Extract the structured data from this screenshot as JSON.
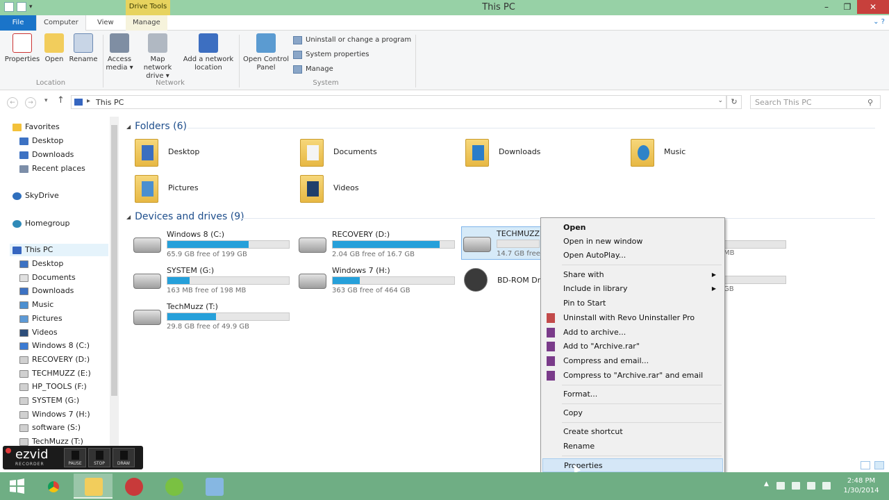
{
  "window": {
    "title": "This PC",
    "contextual_tab": "Drive Tools"
  },
  "ribbon": {
    "tabs": [
      "File",
      "Computer",
      "View",
      "Manage"
    ],
    "location": {
      "group_label": "Location",
      "buttons": [
        "Properties",
        "Open",
        "Rename"
      ]
    },
    "network": {
      "group_label": "Network",
      "access_media": "Access media",
      "map_drive": "Map network drive",
      "add_location": "Add a network location"
    },
    "system": {
      "group_label": "System",
      "open_control_panel": "Open Control Panel",
      "uninstall": "Uninstall or change a program",
      "system_properties": "System properties",
      "manage": "Manage"
    }
  },
  "address": {
    "path": "This PC",
    "search_placeholder": "Search This PC"
  },
  "nav": {
    "favorites": "Favorites",
    "favorites_items": [
      "Desktop",
      "Downloads",
      "Recent places"
    ],
    "skydrive": "SkyDrive",
    "homegroup": "Homegroup",
    "this_pc": "This PC",
    "pc_items": [
      "Desktop",
      "Documents",
      "Downloads",
      "Music",
      "Pictures",
      "Videos",
      "Windows 8 (C:)",
      "RECOVERY (D:)",
      "TECHMUZZ (E:)",
      "HP_TOOLS (F:)",
      "SYSTEM (G:)",
      "Windows 7 (H:)",
      "software (S:)",
      "TechMuzz (T:)"
    ]
  },
  "content": {
    "folders_header": "Folders (6)",
    "folders": [
      "Desktop",
      "Documents",
      "Downloads",
      "Music",
      "Pictures",
      "Videos"
    ],
    "drives_header": "Devices and drives (9)",
    "drives": [
      {
        "name": "Windows 8 (C:)",
        "free": "65.9 GB free of 199 GB",
        "used_fraction": 0.67
      },
      {
        "name": "RECOVERY (D:)",
        "free": "2.04 GB free of 16.7 GB",
        "used_fraction": 0.88
      },
      {
        "name": "TECHMUZZ",
        "free": "14.7 GB free",
        "used_fraction": 0.0
      },
      {
        "name": "SYSTEM (G:)",
        "free": "163 MB free of 198 MB",
        "used_fraction": 0.18
      },
      {
        "name": "Windows 7 (H:)",
        "free": "363 GB free of 464 GB",
        "used_fraction": 0.22
      },
      {
        "name": "BD-ROM Dri",
        "free": "",
        "used_fraction": null
      },
      {
        "name": "TechMuzz (T:)",
        "free": "29.8 GB free of 49.9 GB",
        "used_fraction": 0.4
      }
    ],
    "partial_right": [
      "MB",
      "GB"
    ]
  },
  "context_menu": {
    "items": [
      "Open",
      "Open in new window",
      "Open AutoPlay...",
      "Share with",
      "Include in library",
      "Pin to Start",
      "Uninstall with Revo Uninstaller Pro",
      "Add to archive...",
      "Add to \"Archive.rar\"",
      "Compress and email...",
      "Compress to \"Archive.rar\" and email",
      "Format...",
      "Copy",
      "Create shortcut",
      "Rename",
      "Properties"
    ]
  },
  "ezvid": {
    "logo": "ezvid",
    "sub": "RECORDER",
    "buttons": [
      "PAUSE",
      "STOP",
      "DRAW"
    ]
  },
  "taskbar": {
    "time": "2:48 PM",
    "date": "1/30/2014"
  },
  "colors": {
    "titlebar": "#97d1a6",
    "drive_tools": "#e7d35e",
    "file_tab": "#1a74c9",
    "taskbar": "#6fae84",
    "drive_bar": "#26a0da",
    "accent_text": "#1e4e8c"
  }
}
